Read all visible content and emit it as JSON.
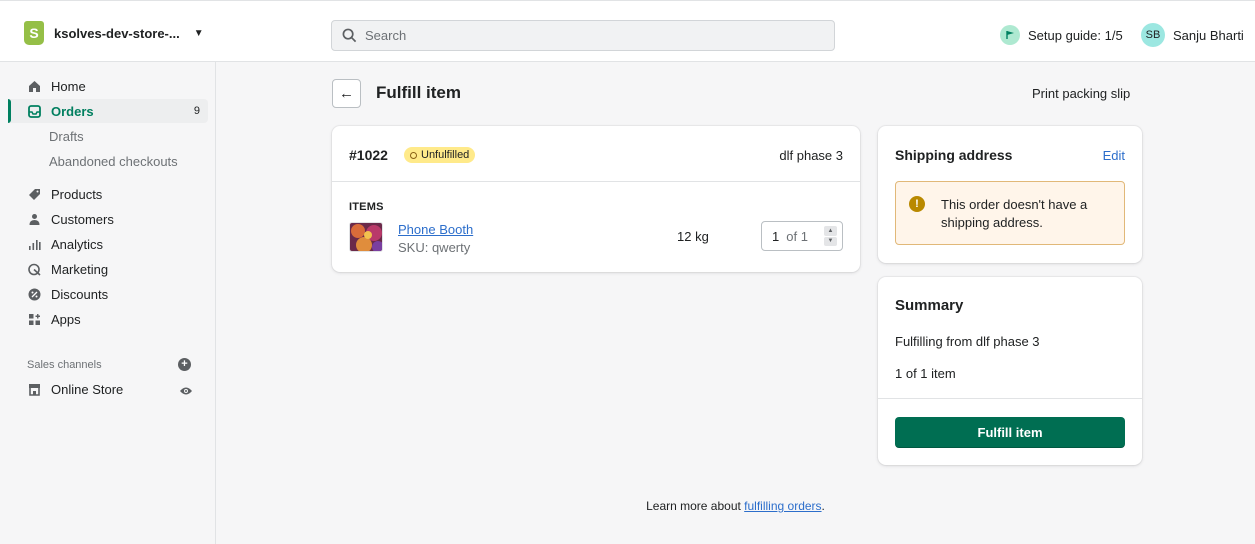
{
  "topbar": {
    "store_name": "ksolves-dev-store-...",
    "store_logo_letter": "S",
    "search_placeholder": "Search",
    "setup_guide": "Setup guide: 1/5",
    "user_initials": "SB",
    "user_name": "Sanju Bharti"
  },
  "sidebar": {
    "home": "Home",
    "orders": "Orders",
    "orders_count": "9",
    "drafts": "Drafts",
    "abandoned": "Abandoned checkouts",
    "products": "Products",
    "customers": "Customers",
    "analytics": "Analytics",
    "marketing": "Marketing",
    "discounts": "Discounts",
    "apps": "Apps",
    "sales_channels": "Sales channels",
    "online_store": "Online Store"
  },
  "page": {
    "title": "Fulfill item",
    "print_link": "Print packing slip"
  },
  "order_card": {
    "order_number": "#1022",
    "status": "Unfulfilled",
    "location": "dlf phase 3",
    "items_label": "ITEMS",
    "product_name": "Phone Booth",
    "sku": "SKU: qwerty",
    "weight": "12 kg",
    "quantity": "1",
    "quantity_of": "of 1"
  },
  "shipping_card": {
    "title": "Shipping address",
    "edit": "Edit",
    "warning": "This order doesn't have a shipping address."
  },
  "summary_card": {
    "title": "Summary",
    "line1": "Fulfilling from dlf phase 3",
    "line2": "1 of 1 item",
    "button": "Fulfill item"
  },
  "footer": {
    "prefix": "Learn more about ",
    "link": "fulfilling orders",
    "suffix": "."
  },
  "colors": {
    "accent": "#008060",
    "button": "#006e52",
    "status_badge": "#ffea8a",
    "warning_bg": "#fff5ea",
    "link": "#2c6ecb"
  }
}
